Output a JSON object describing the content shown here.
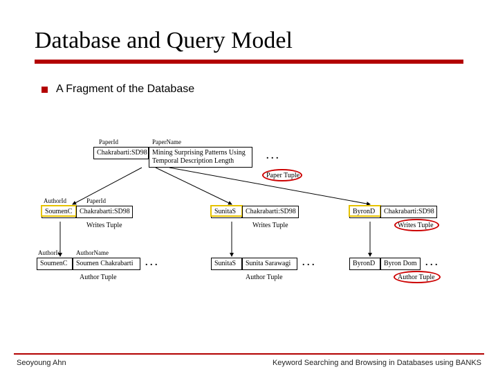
{
  "title": "Database and Query Model",
  "bullet": "A Fragment of the Database",
  "headers": {
    "paperId": "PaperId",
    "paperName": "PaperName",
    "authorId": "AuthorId",
    "authorName": "AuthorName"
  },
  "paper": {
    "id": "Chakrabarti:SD98",
    "name": "Mining Surprising Patterns Using Temporal Description Length",
    "label": "Paper Tuple"
  },
  "writes": [
    {
      "authorId": "SoumenC",
      "paperId": "Chakrabarti:SD98",
      "label": "Writes Tuple"
    },
    {
      "authorId": "SunitaS",
      "paperId": "Chakrabarti:SD98",
      "label": "Writes Tuple"
    },
    {
      "authorId": "ByronD",
      "paperId": "Chakrabarti:SD98",
      "label": "Writes Tuple"
    }
  ],
  "authors": [
    {
      "id": "SoumenC",
      "name": "Soumen Chakrabarti",
      "label": "Author Tuple"
    },
    {
      "id": "SunitaS",
      "name": "Sunita Sarawagi",
      "label": "Author Tuple"
    },
    {
      "id": "ByronD",
      "name": "Byron Dom",
      "label": "Author Tuple"
    }
  ],
  "ellipsis": ". . .",
  "footer": {
    "left": "Seoyoung Ahn",
    "right": "Keyword Searching and Browsing in Databases using BANKS"
  }
}
